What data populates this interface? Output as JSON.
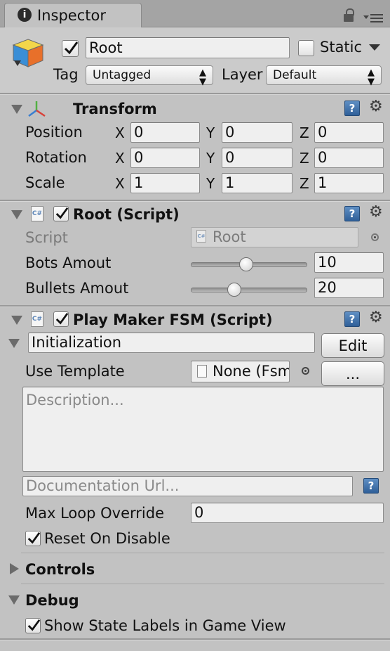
{
  "tab": {
    "title": "Inspector"
  },
  "header": {
    "object_name": "Root",
    "static_label": "Static",
    "tag_label": "Tag",
    "tag_value": "Untagged",
    "layer_label": "Layer",
    "layer_value": "Default",
    "active": true,
    "static": false
  },
  "transform": {
    "title": "Transform",
    "rows": [
      {
        "label": "Position",
        "x": "0",
        "y": "0",
        "z": "0"
      },
      {
        "label": "Rotation",
        "x": "0",
        "y": "0",
        "z": "0"
      },
      {
        "label": "Scale",
        "x": "1",
        "y": "1",
        "z": "1"
      }
    ],
    "axis_x": "X",
    "axis_y": "Y",
    "axis_z": "Z"
  },
  "root_script": {
    "title": "Root (Script)",
    "script_label": "Script",
    "script_value": "Root",
    "bots_label": "Bots Amout",
    "bots_value": "10",
    "bots_slider": 0.48,
    "bullets_label": "Bullets Amout",
    "bullets_value": "20",
    "bullets_slider": 0.36
  },
  "playmaker": {
    "title": "Play Maker FSM (Script)",
    "fsm_name": "Initialization",
    "edit_button": "Edit",
    "use_template_label": "Use Template",
    "template_value": "None (Fsm",
    "dots_button": "...",
    "description_placeholder": "Description...",
    "doc_url_placeholder": "Documentation Url...",
    "max_loop_label": "Max Loop Override",
    "max_loop_value": "0",
    "reset_label": "Reset On Disable",
    "reset_checked": true,
    "controls_label": "Controls",
    "debug_label": "Debug",
    "show_labels": "Show State Labels in Game View",
    "show_labels_checked": true
  },
  "icons": {
    "info": "info-icon",
    "lock": "lock-icon",
    "menu": "context-menu-icon",
    "cube": "gameobject-cube-icon",
    "help": "help-book-icon",
    "gear": "gear-icon"
  }
}
